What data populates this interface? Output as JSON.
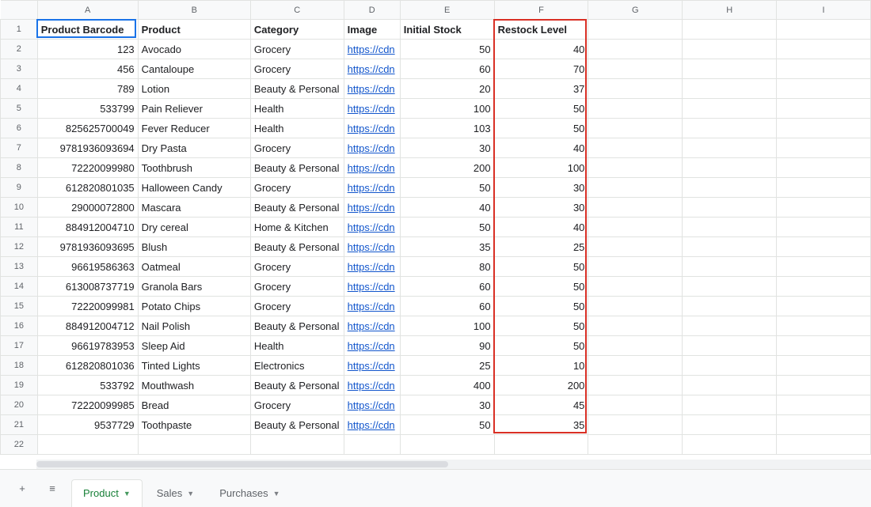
{
  "columns": [
    "A",
    "B",
    "C",
    "D",
    "E",
    "F",
    "G",
    "H",
    "I"
  ],
  "row_count": 22,
  "active_cell": "A1",
  "highlight_column": "F",
  "headers": {
    "A": "Product Barcode",
    "B": "Product",
    "C": "Category",
    "D": "Image",
    "E": "Initial Stock",
    "F": "Restock Level"
  },
  "link_text": "https://cdn",
  "rows": [
    {
      "barcode": 123,
      "product": "Avocado",
      "category": "Grocery",
      "image": "link",
      "initial_stock": 50,
      "restock_level": 40
    },
    {
      "barcode": 456,
      "product": "Cantaloupe",
      "category": "Grocery",
      "image": "link",
      "initial_stock": 60,
      "restock_level": 70
    },
    {
      "barcode": 789,
      "product": "Lotion",
      "category": "Beauty & Personal",
      "image": "link",
      "initial_stock": 20,
      "restock_level": 37
    },
    {
      "barcode": 533799,
      "product": "Pain Reliever",
      "category": "Health",
      "image": "link",
      "initial_stock": 100,
      "restock_level": 50
    },
    {
      "barcode": 825625700049,
      "product": "Fever Reducer",
      "category": "Health",
      "image": "link",
      "initial_stock": 103,
      "restock_level": 50
    },
    {
      "barcode": 9781936093694,
      "product": "Dry Pasta",
      "category": "Grocery",
      "image": "link",
      "initial_stock": 30,
      "restock_level": 40
    },
    {
      "barcode": 72220099980,
      "product": "Toothbrush",
      "category": "Beauty & Personal",
      "image": "link",
      "initial_stock": 200,
      "restock_level": 100
    },
    {
      "barcode": 612820801035,
      "product": "Halloween Candy",
      "category": "Grocery",
      "image": "link",
      "initial_stock": 50,
      "restock_level": 30
    },
    {
      "barcode": 29000072800,
      "product": "Mascara",
      "category": "Beauty & Personal",
      "image": "link",
      "initial_stock": 40,
      "restock_level": 30
    },
    {
      "barcode": 884912004710,
      "product": "Dry cereal",
      "category": "Home & Kitchen",
      "image": "link",
      "initial_stock": 50,
      "restock_level": 40
    },
    {
      "barcode": 9781936093695,
      "product": "Blush",
      "category": "Beauty & Personal",
      "image": "link",
      "initial_stock": 35,
      "restock_level": 25
    },
    {
      "barcode": 96619586363,
      "product": "Oatmeal",
      "category": "Grocery",
      "image": "link",
      "initial_stock": 80,
      "restock_level": 50
    },
    {
      "barcode": 613008737719,
      "product": "Granola Bars",
      "category": "Grocery",
      "image": "link",
      "initial_stock": 60,
      "restock_level": 50
    },
    {
      "barcode": 72220099981,
      "product": "Potato Chips",
      "category": "Grocery",
      "image": "link",
      "initial_stock": 60,
      "restock_level": 50
    },
    {
      "barcode": 884912004712,
      "product": "Nail Polish",
      "category": "Beauty & Personal",
      "image": "link",
      "initial_stock": 100,
      "restock_level": 50
    },
    {
      "barcode": 96619783953,
      "product": "Sleep Aid",
      "category": "Health",
      "image": "link",
      "initial_stock": 90,
      "restock_level": 50
    },
    {
      "barcode": 612820801036,
      "product": "Tinted Lights",
      "category": "Electronics",
      "image": "link",
      "initial_stock": 25,
      "restock_level": 10
    },
    {
      "barcode": 533792,
      "product": "Mouthwash",
      "category": "Beauty & Personal",
      "image": "link",
      "initial_stock": 400,
      "restock_level": 200
    },
    {
      "barcode": 72220099985,
      "product": "Bread",
      "category": "Grocery",
      "image": "link",
      "initial_stock": 30,
      "restock_level": 45
    },
    {
      "barcode": 9537729,
      "product": "Toothpaste",
      "category": "Beauty & Personal",
      "image": "link",
      "initial_stock": 50,
      "restock_level": 35
    }
  ],
  "tabs": [
    {
      "id": "product",
      "label": "Product",
      "active": true
    },
    {
      "id": "sales",
      "label": "Sales",
      "active": false
    },
    {
      "id": "purchases",
      "label": "Purchases",
      "active": false
    }
  ],
  "icons": {
    "plus": "+",
    "menu": "≡",
    "caret": "▼"
  }
}
